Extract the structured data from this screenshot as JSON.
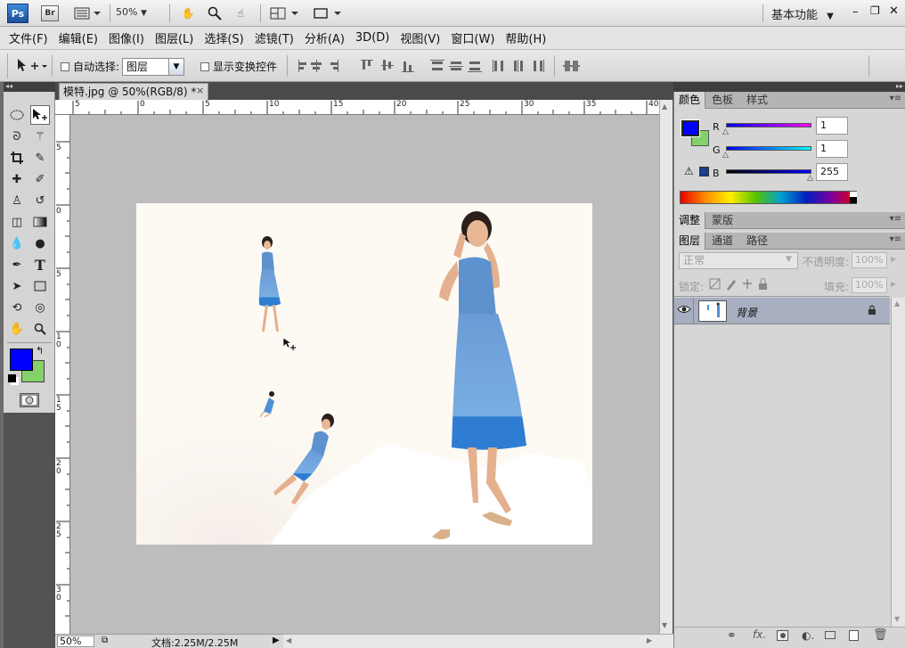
{
  "app": {
    "logo": "Ps",
    "bridge": "Br",
    "zoom": "50%",
    "workspace": "基本功能"
  },
  "menu": [
    "文件(F)",
    "编辑(E)",
    "图像(I)",
    "图层(L)",
    "选择(S)",
    "滤镜(T)",
    "分析(A)",
    "3D(D)",
    "视图(V)",
    "窗口(W)",
    "帮助(H)"
  ],
  "options": {
    "auto_select_label": "自动选择:",
    "auto_select_value": "图层",
    "show_transform_label": "显示变换控件"
  },
  "document": {
    "tab_title": "模特.jpg @ 50%(RGB/8) *",
    "close": "×"
  },
  "ruler_h": [
    "5",
    "0",
    "5",
    "10",
    "15",
    "20",
    "25",
    "30",
    "35",
    "40"
  ],
  "ruler_v": [
    "5",
    "0",
    "5",
    "1 0",
    "1 5",
    "2 0",
    "2 5",
    "3 0"
  ],
  "status": {
    "zoom": "50%",
    "doc_size": "文档:2.25M/2.25M"
  },
  "color_panel": {
    "tabs": [
      "颜色",
      "色板",
      "样式"
    ],
    "fg_color": "#0000ff",
    "bg_color": "#84d06a",
    "r_label": "R",
    "g_label": "G",
    "b_label": "B",
    "r_value": "1",
    "g_value": "1",
    "b_value": "255"
  },
  "adjust_panel": {
    "tabs": [
      "调整",
      "蒙版"
    ]
  },
  "layers_panel": {
    "tabs": [
      "图层",
      "通道",
      "路径"
    ],
    "blend_mode": "正常",
    "opacity_label": "不透明度:",
    "opacity_value": "100%",
    "lock_label": "锁定:",
    "fill_label": "填充:",
    "fill_value": "100%",
    "layers": [
      {
        "name": "背景"
      }
    ]
  },
  "colors": {
    "accent": "#1a5fb4",
    "layer_selected": "#a7afc0"
  }
}
